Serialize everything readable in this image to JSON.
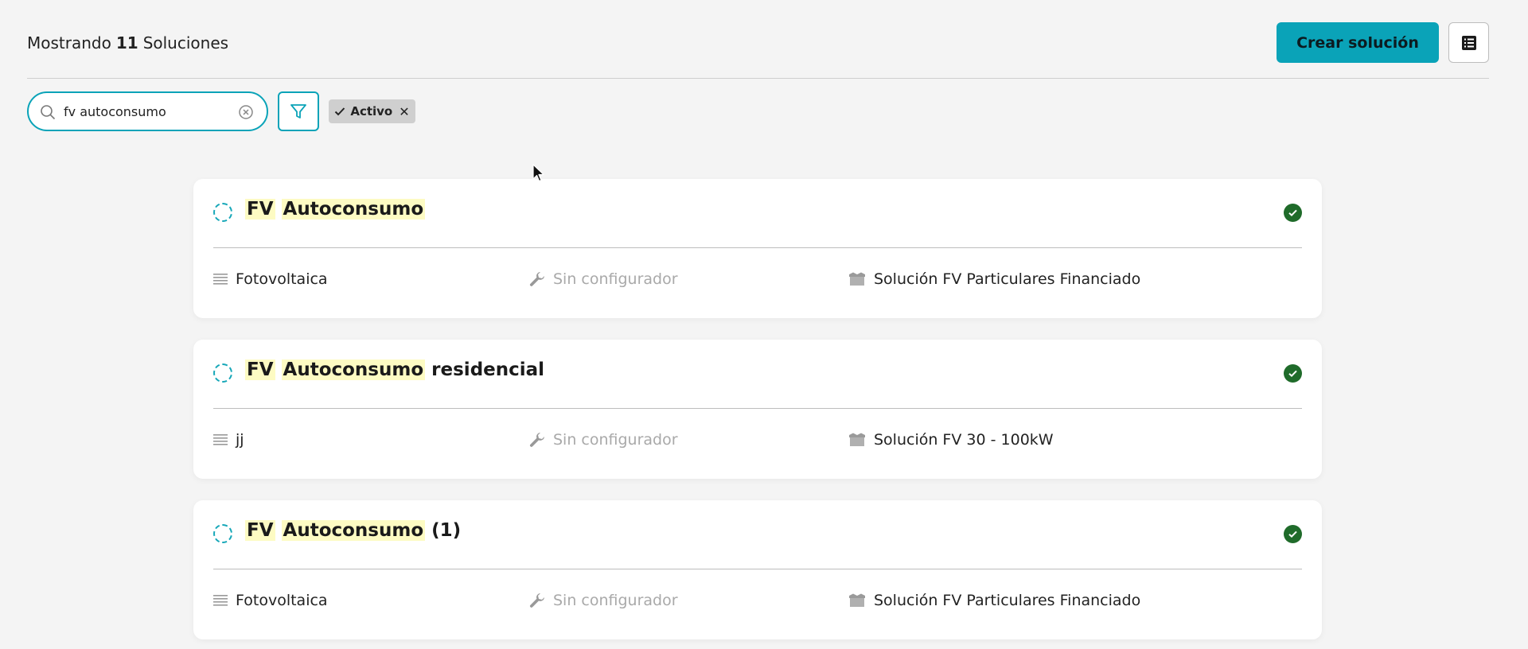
{
  "header": {
    "count_prefix": "Mostrando",
    "count_value": "11",
    "count_suffix": "Soluciones",
    "create_label": "Crear solución"
  },
  "search": {
    "value": "fv autoconsumo",
    "placeholder": ""
  },
  "filter_chip": {
    "label": "Activo",
    "close_symbol": "✕"
  },
  "icons": {
    "search": "search-icon",
    "clear": "clear-circle-icon",
    "filter": "funnel-icon",
    "list": "list-view-icon",
    "status": "check-circle-icon",
    "category": "lines-icon",
    "configurator": "wrench-icon",
    "package": "box-icon"
  },
  "colors": {
    "accent": "#0aa3b8",
    "highlight": "#fdfbc3",
    "status_ok": "#1f6b2a"
  },
  "cards": [
    {
      "title_hl1": "FV",
      "title_hl2": "Autoconsumo",
      "title_rest": "",
      "category": "Fotovoltaica",
      "configurator": "Sin configurador",
      "solution": "Solución FV Particulares Financiado"
    },
    {
      "title_hl1": "FV",
      "title_hl2": "Autoconsumo",
      "title_rest": "residencial",
      "category": "jj",
      "configurator": "Sin configurador",
      "solution": "Solución FV 30 - 100kW"
    },
    {
      "title_hl1": "FV",
      "title_hl2": "Autoconsumo",
      "title_rest": "(1)",
      "category": "Fotovoltaica",
      "configurator": "Sin configurador",
      "solution": "Solución FV Particulares Financiado"
    }
  ]
}
